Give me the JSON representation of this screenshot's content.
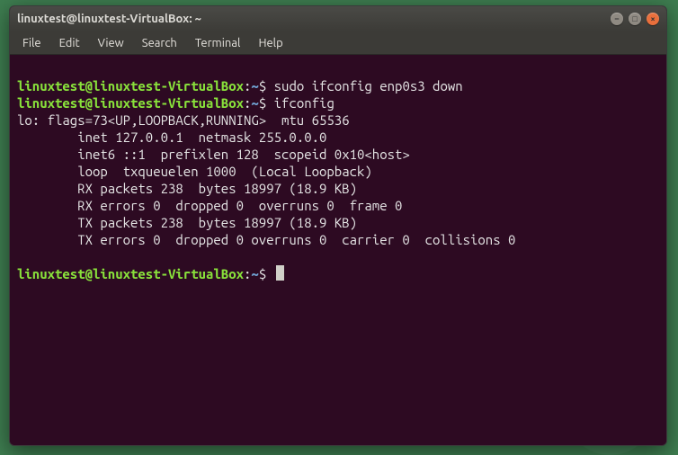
{
  "window": {
    "title": "linuxtest@linuxtest-VirtualBox: ~"
  },
  "menu": {
    "file": "File",
    "edit": "Edit",
    "view": "View",
    "search": "Search",
    "terminal": "Terminal",
    "help": "Help"
  },
  "prompt": {
    "user_host": "linuxtest@linuxtest-VirtualBox",
    "sep1": ":",
    "path": "~",
    "sep2": "$ "
  },
  "lines": {
    "cmd1": "sudo ifconfig enp0s3 down",
    "cmd2": "ifconfig",
    "out1": "lo: flags=73<UP,LOOPBACK,RUNNING>  mtu 65536",
    "out2": "        inet 127.0.0.1  netmask 255.0.0.0",
    "out3": "        inet6 ::1  prefixlen 128  scopeid 0x10<host>",
    "out4": "        loop  txqueuelen 1000  (Local Loopback)",
    "out5": "        RX packets 238  bytes 18997 (18.9 KB)",
    "out6": "        RX errors 0  dropped 0  overruns 0  frame 0",
    "out7": "        TX packets 238  bytes 18997 (18.9 KB)",
    "out8": "        TX errors 0  dropped 0 overruns 0  carrier 0  collisions 0"
  },
  "icons": {
    "min": "–",
    "max": "□",
    "close": "×"
  }
}
